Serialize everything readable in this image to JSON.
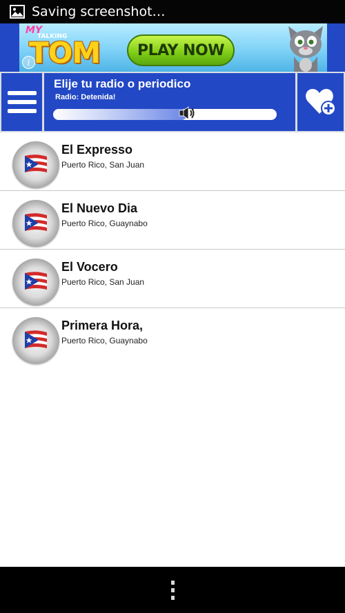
{
  "status_bar": {
    "text": "Saving screenshot…",
    "icon": "image-icon"
  },
  "ad": {
    "brand_my": "MY",
    "brand_talking": "TALKING",
    "brand_tom": "TOM",
    "cta": "PLAY NOW",
    "info_icon": "info-icon"
  },
  "header": {
    "title": "Elije tu radio o periodico",
    "status": "Radio: Detenida!",
    "volume_level": 0.6,
    "menu_icon": "hamburger-menu-icon",
    "volume_icon": "speaker-icon",
    "favorite_icon": "heart-plus-icon"
  },
  "stations": [
    {
      "name": "El Expresso",
      "location": "Puerto Rico, San Juan",
      "icon": "puerto-rico-flag-icon"
    },
    {
      "name": "El Nuevo Dia",
      "location": "Puerto Rico, Guaynabo",
      "icon": "puerto-rico-flag-icon"
    },
    {
      "name": "El Vocero",
      "location": "Puerto Rico, San Juan",
      "icon": "puerto-rico-flag-icon"
    },
    {
      "name": "Primera Hora,",
      "location": "Puerto Rico, Guaynabo",
      "icon": "puerto-rico-flag-icon"
    }
  ],
  "nav_bar": {
    "overflow_icon": "overflow-menu-icon"
  },
  "colors": {
    "header_blue": "#2348c5",
    "list_divider": "#c8c8c8"
  }
}
